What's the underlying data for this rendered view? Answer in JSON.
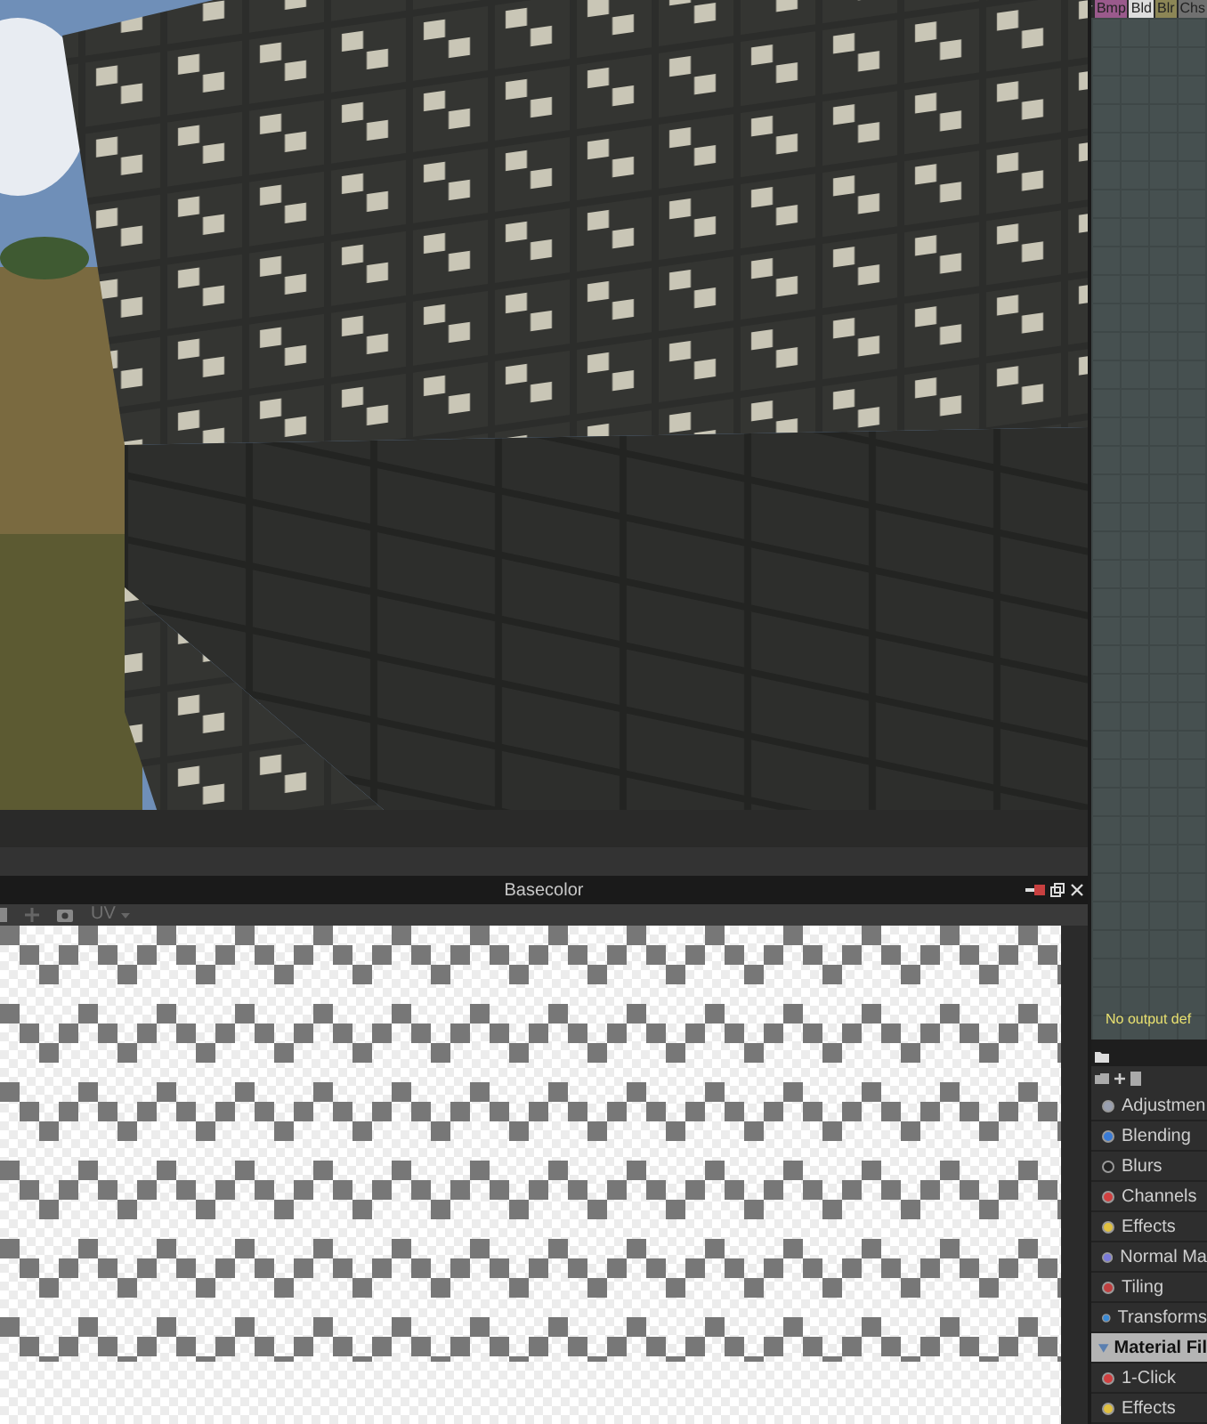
{
  "graph_tabs": [
    {
      "label": "Bmp",
      "color": "#9a5a8c"
    },
    {
      "label": "Bld",
      "color": "#dcdcdc"
    },
    {
      "label": "Blr",
      "color": "#8c8656"
    },
    {
      "label": "Chs",
      "color": "#707070"
    }
  ],
  "basecolor_panel": {
    "title": "Basecolor",
    "view_mode": "UV"
  },
  "graph": {
    "message": "No output def"
  },
  "library": {
    "items": [
      {
        "kind": "item",
        "label": "Adjustmen"
      },
      {
        "kind": "item",
        "label": "Blending"
      },
      {
        "kind": "item",
        "label": "Blurs"
      },
      {
        "kind": "item",
        "label": "Channels"
      },
      {
        "kind": "item",
        "label": "Effects"
      },
      {
        "kind": "item",
        "label": "Normal Ma"
      },
      {
        "kind": "item",
        "label": "Tiling"
      },
      {
        "kind": "item",
        "label": "Transforms"
      },
      {
        "kind": "header",
        "label": "Material Fil",
        "expanded": true
      },
      {
        "kind": "item",
        "label": "1-Click"
      },
      {
        "kind": "item",
        "label": "Effects"
      }
    ]
  }
}
